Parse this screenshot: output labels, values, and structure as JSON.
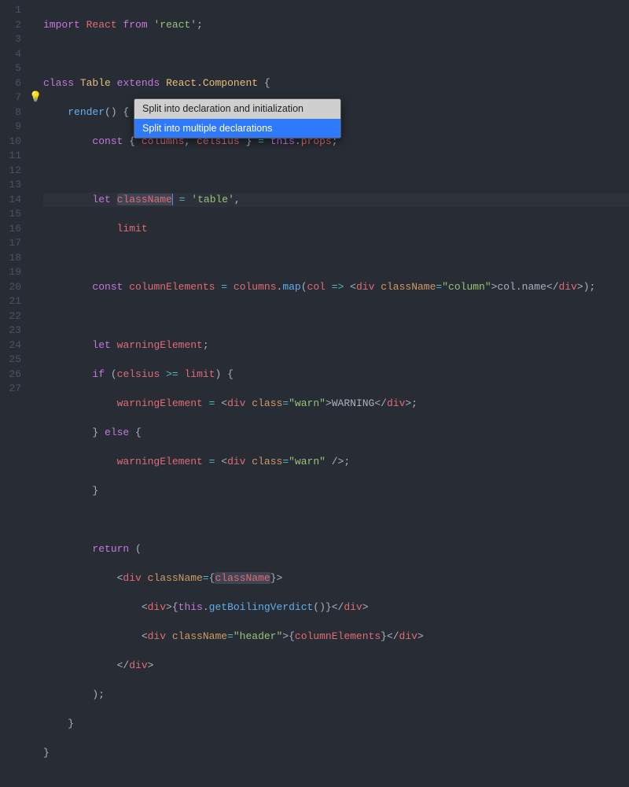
{
  "gutterStart": 1,
  "gutterEnd": 27,
  "popup": {
    "item1": "Split into declaration and initialization",
    "item2": "Split into multiple declarations"
  },
  "bulb": "💡",
  "code": {
    "l1_import": "import",
    "l1_react": "React",
    "l1_from": "from",
    "l1_str": "'react'",
    "l3_class": "class",
    "l3_table": "Table",
    "l3_extends": "extends",
    "l3_rc": "React.Component",
    "l4_render": "render",
    "l5_const": "const",
    "l5_cols": "columns",
    "l5_cels": "celsius",
    "l5_this": "this",
    "l5_props": "props",
    "l7_let": "let",
    "l7_cn": "className",
    "l7_str": "'table'",
    "l8_limit": "limit",
    "l10_const": "const",
    "l10_ce": "columnElements",
    "l10_cols": "columns",
    "l10_map": "map",
    "l10_col": "col",
    "l10_div": "div",
    "l10_cnattr": "className",
    "l10_colstr": "\"column\"",
    "l10_colname": "col.name",
    "l12_let": "let",
    "l12_we": "warningElement",
    "l13_if": "if",
    "l13_cels": "celsius",
    "l13_limit": "limit",
    "l14_we": "warningElement",
    "l14_div": "div",
    "l14_class": "class",
    "l14_warn": "\"warn\"",
    "l14_warning": "WARNING",
    "l15_else": "else",
    "l16_we": "warningElement",
    "l16_div": "div",
    "l16_class": "class",
    "l16_warn": "\"warn\"",
    "l19_return": "return",
    "l20_div": "div",
    "l20_cnattr": "className",
    "l20_cn": "className",
    "l21_div": "div",
    "l21_this": "this",
    "l21_gbv": "getBoilingVerdict",
    "l22_div": "div",
    "l22_cnattr": "className",
    "l22_header": "\"header\"",
    "l22_ce": "columnElements",
    "l23_div": "div"
  }
}
